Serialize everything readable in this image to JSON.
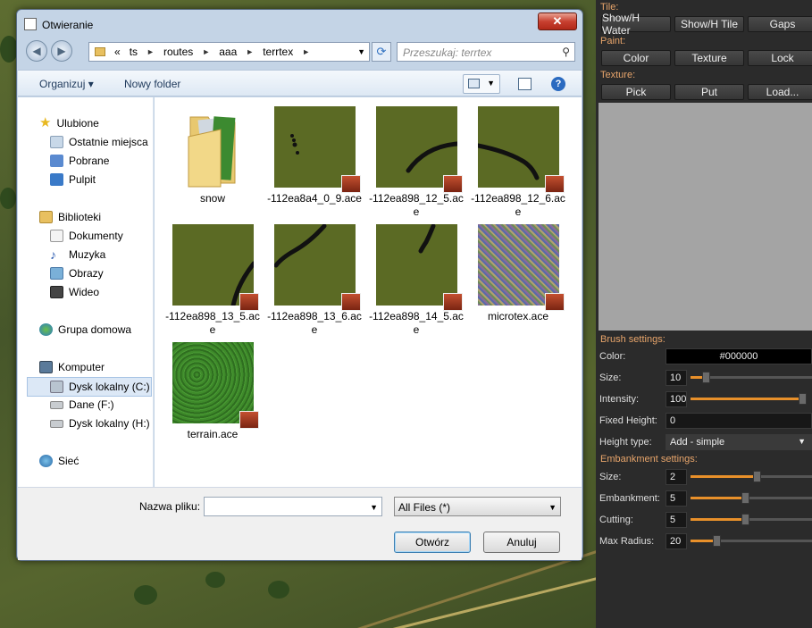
{
  "dialog": {
    "title": "Otwieranie",
    "close_glyph": "✕",
    "address": {
      "prefix": "«",
      "crumbs": [
        "ts",
        "routes",
        "aaa",
        "terrtex"
      ],
      "separator": "►",
      "dropdown": "▼"
    },
    "search_placeholder": "Przeszukaj: terrtex",
    "toolbar": {
      "organize": "Organizuj ▾",
      "new_folder": "Nowy folder",
      "help": "?"
    },
    "nav": {
      "favorites": {
        "title": "Ulubione",
        "items": [
          "Ostatnie miejsca",
          "Pobrane",
          "Pulpit"
        ]
      },
      "libraries": {
        "title": "Biblioteki",
        "items": [
          "Dokumenty",
          "Muzyka",
          "Obrazy",
          "Wideo"
        ]
      },
      "homegroup": "Grupa domowa",
      "computer": {
        "title": "Komputer",
        "items": [
          "Dysk lokalny (C:)",
          "Dane (F:)",
          "Dysk lokalny (H:)"
        ]
      },
      "network": "Sieć"
    },
    "files": [
      {
        "name": "snow",
        "kind": "folder"
      },
      {
        "name": "-112ea8a4_0_9.ace",
        "kind": "terrain-dots"
      },
      {
        "name": "-112ea898_12_5.ace",
        "kind": "terrain-curve-up"
      },
      {
        "name": "-112ea898_12_6.ace",
        "kind": "terrain-curve-arc"
      },
      {
        "name": "-112ea898_13_5.ace",
        "kind": "terrain-curve-left"
      },
      {
        "name": "-112ea898_13_6.ace",
        "kind": "terrain-curve-diag"
      },
      {
        "name": "-112ea898_14_5.ace",
        "kind": "terrain-curve-small"
      },
      {
        "name": "microtex.ace",
        "kind": "noise"
      },
      {
        "name": "terrain.ace",
        "kind": "grass"
      }
    ],
    "bottom": {
      "filename_label": "Nazwa pliku:",
      "filename_value": "",
      "filetype": "All Files  (*)",
      "open": "Otwórz",
      "cancel": "Anuluj"
    }
  },
  "panel": {
    "tile_label": "Tile:",
    "tile_buttons": [
      "Show/H Water",
      "Show/H Tile",
      "Gaps"
    ],
    "paint_label": "Paint:",
    "paint_buttons": [
      "Color",
      "Texture",
      "Lock"
    ],
    "texture_label": "Texture:",
    "texture_buttons": [
      "Pick",
      "Put",
      "Load..."
    ],
    "brush_label": "Brush settings:",
    "color_label": "Color:",
    "color_value": "#000000",
    "size_label": "Size:",
    "size_value": "10",
    "size_level": 0.1,
    "intensity_label": "Intensity:",
    "intensity_value": "100",
    "intensity_level": 1.0,
    "fixed_height_label": "Fixed Height:",
    "fixed_height_value": "0",
    "height_type_label": "Height type:",
    "height_type_value": "Add - simple",
    "embankment_label": "Embankment settings:",
    "emb_size_label": "Size:",
    "emb_size_value": "2",
    "emb_size_level": 0.55,
    "embankment_field_label": "Embankment:",
    "embankment_value": "5",
    "embankment_level": 0.45,
    "cutting_label": "Cutting:",
    "cutting_value": "5",
    "cutting_level": 0.45,
    "max_radius_label": "Max Radius:",
    "max_radius_value": "20",
    "max_radius_level": 0.2
  },
  "colors": {
    "accent": "#e8902a",
    "panel_bg": "#2b2b2b",
    "section_label": "#e8a56b"
  }
}
